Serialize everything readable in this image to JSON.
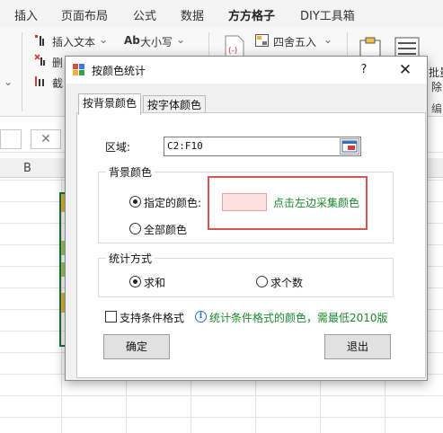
{
  "excel": {
    "ribbon_tabs": [
      "插入",
      "页面布局",
      "公式",
      "数据",
      "方方格子",
      "DIY工具箱"
    ],
    "active_tab": "方方格子",
    "ribbon_items": {
      "insert_text": "插入文本",
      "delete": "删",
      "truncate": "截",
      "font_size": "大小写",
      "round": "四舍五入",
      "batch": "批量",
      "remove": "除",
      "edit": "编"
    },
    "column_header": "B"
  },
  "dialog": {
    "title": "按颜色统计",
    "help_label": "?",
    "close_label": "✕",
    "tabs": [
      "按背景颜色",
      "按字体颜色"
    ],
    "active_tab_index": 0,
    "range_label": "区域:",
    "range_value": "C2:F10",
    "background_group_title": "背景颜色",
    "specified_color_label": "指定的颜色:",
    "pick_color_hint": "点击左边采集颜色",
    "all_colors_label": "全部颜色",
    "stat_group_title": "统计方式",
    "sum_label": "求和",
    "count_label": "求个数",
    "conditional_format_label": "支持条件格式",
    "conditional_format_info": "统计条件格式的颜色，需最低2010版",
    "ok_label": "确定",
    "exit_label": "退出",
    "selected_color": "#fde0e0",
    "highlight_color": "#d9534f",
    "hint_color": "#1a8a2a",
    "radio_background": "specified",
    "radio_method": "sum",
    "conditional_format_checked": false
  }
}
